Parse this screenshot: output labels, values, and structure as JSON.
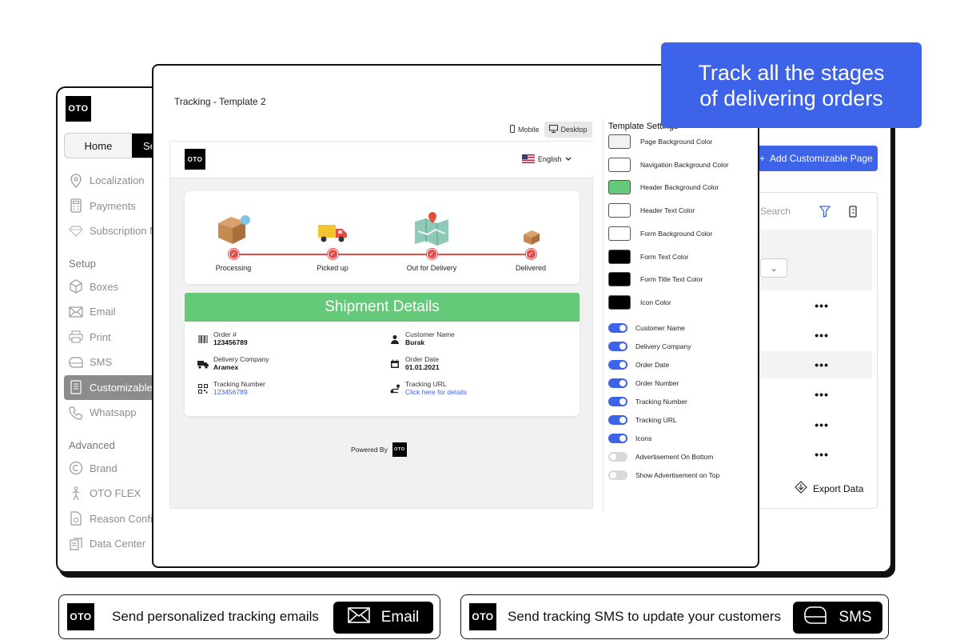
{
  "callout": {
    "line1": "Track all the stages",
    "line2": "of delivering orders"
  },
  "back_window": {
    "logo": "OTO",
    "seg_home": "Home",
    "seg_settings": "Se",
    "menu": [
      {
        "label": "Localization",
        "icon": "location-pin-icon"
      },
      {
        "label": "Payments",
        "icon": "calculator-icon"
      },
      {
        "label": "Subscription M",
        "icon": "diamond-icon"
      }
    ],
    "setup_heading": "Setup",
    "setup_items": [
      {
        "label": "Boxes",
        "icon": "box-icon"
      },
      {
        "label": "Email",
        "icon": "envelope-icon"
      },
      {
        "label": "Print",
        "icon": "printer-icon"
      },
      {
        "label": "SMS",
        "icon": "chat-bubble-icon"
      },
      {
        "label": "Customizable",
        "icon": "document-icon"
      },
      {
        "label": "Whatsapp",
        "icon": "phone-icon"
      }
    ],
    "advanced_heading": "Advanced",
    "advanced_items": [
      {
        "label": "Brand",
        "icon": "copyright-icon"
      },
      {
        "label": "OTO FLEX",
        "icon": "walker-icon"
      },
      {
        "label": "Reason Config",
        "icon": "gear-document-icon"
      },
      {
        "label": "Data Center",
        "icon": "database-icon"
      }
    ],
    "add_button": "Add Customizable Page",
    "search_placeholder": "Search",
    "row_more": "•••",
    "export_label": "Export Data"
  },
  "front_window": {
    "title": "Tracking - Template 2",
    "mobile_label": "Mobile",
    "desktop_label": "Desktop",
    "preview": {
      "logo": "OTO",
      "language": "English",
      "stages": [
        {
          "label": "Processing"
        },
        {
          "label": "Picked up"
        },
        {
          "label": "Out for Delivery"
        },
        {
          "label": "Delivered"
        }
      ],
      "shipment_title": "Shipment Details",
      "fields": {
        "order_label": "Order #",
        "order_value": "123456789",
        "customer_label": "Customer Name",
        "customer_value": "Burak",
        "company_label": "Delivery Company",
        "company_value": "Aramex",
        "date_label": "Order Date",
        "date_value": "01.01.2021",
        "tracking_label": "Tracking Number",
        "tracking_value": "123456789",
        "url_label": "Tracking URL",
        "url_value": "Click here for details"
      },
      "powered_by": "Powered By",
      "powered_logo": "OTO"
    },
    "settings": {
      "title": "Template Settings",
      "colors": [
        {
          "label": "Page Background Color",
          "color": "#f1f1f1"
        },
        {
          "label": "Navigation Background Color",
          "color": "#ffffff"
        },
        {
          "label": "Header Background Color",
          "color": "#65c97a"
        },
        {
          "label": "Header Text Color",
          "color": "#ffffff"
        },
        {
          "label": "Form Background Color",
          "color": "#ffffff"
        },
        {
          "label": "Form Text Color",
          "color": "#000000"
        },
        {
          "label": "Form Title Text Color",
          "color": "#000000"
        },
        {
          "label": "Icon Color",
          "color": "#000000"
        }
      ],
      "toggles": [
        {
          "label": "Customer Name",
          "on": true
        },
        {
          "label": "Delivery Company",
          "on": true
        },
        {
          "label": "Order Date",
          "on": true
        },
        {
          "label": "Order Number",
          "on": true
        },
        {
          "label": "Tracking Number",
          "on": true
        },
        {
          "label": "Tracking URL",
          "on": true
        },
        {
          "label": "Icons",
          "on": true
        },
        {
          "label": "Advertisement On Bottom",
          "on": false
        },
        {
          "label": "Show Advertisement on Top",
          "on": false
        }
      ]
    }
  },
  "pill_email": {
    "logo": "OTO",
    "text": "Send personalized tracking emails",
    "button": "Email"
  },
  "pill_sms": {
    "logo": "OTO",
    "text": "Send tracking SMS to update your customers",
    "button": "SMS"
  },
  "colors": {
    "accent": "#3d63e9",
    "header_green": "#65c97a",
    "stage_red": "#e74c4c"
  }
}
